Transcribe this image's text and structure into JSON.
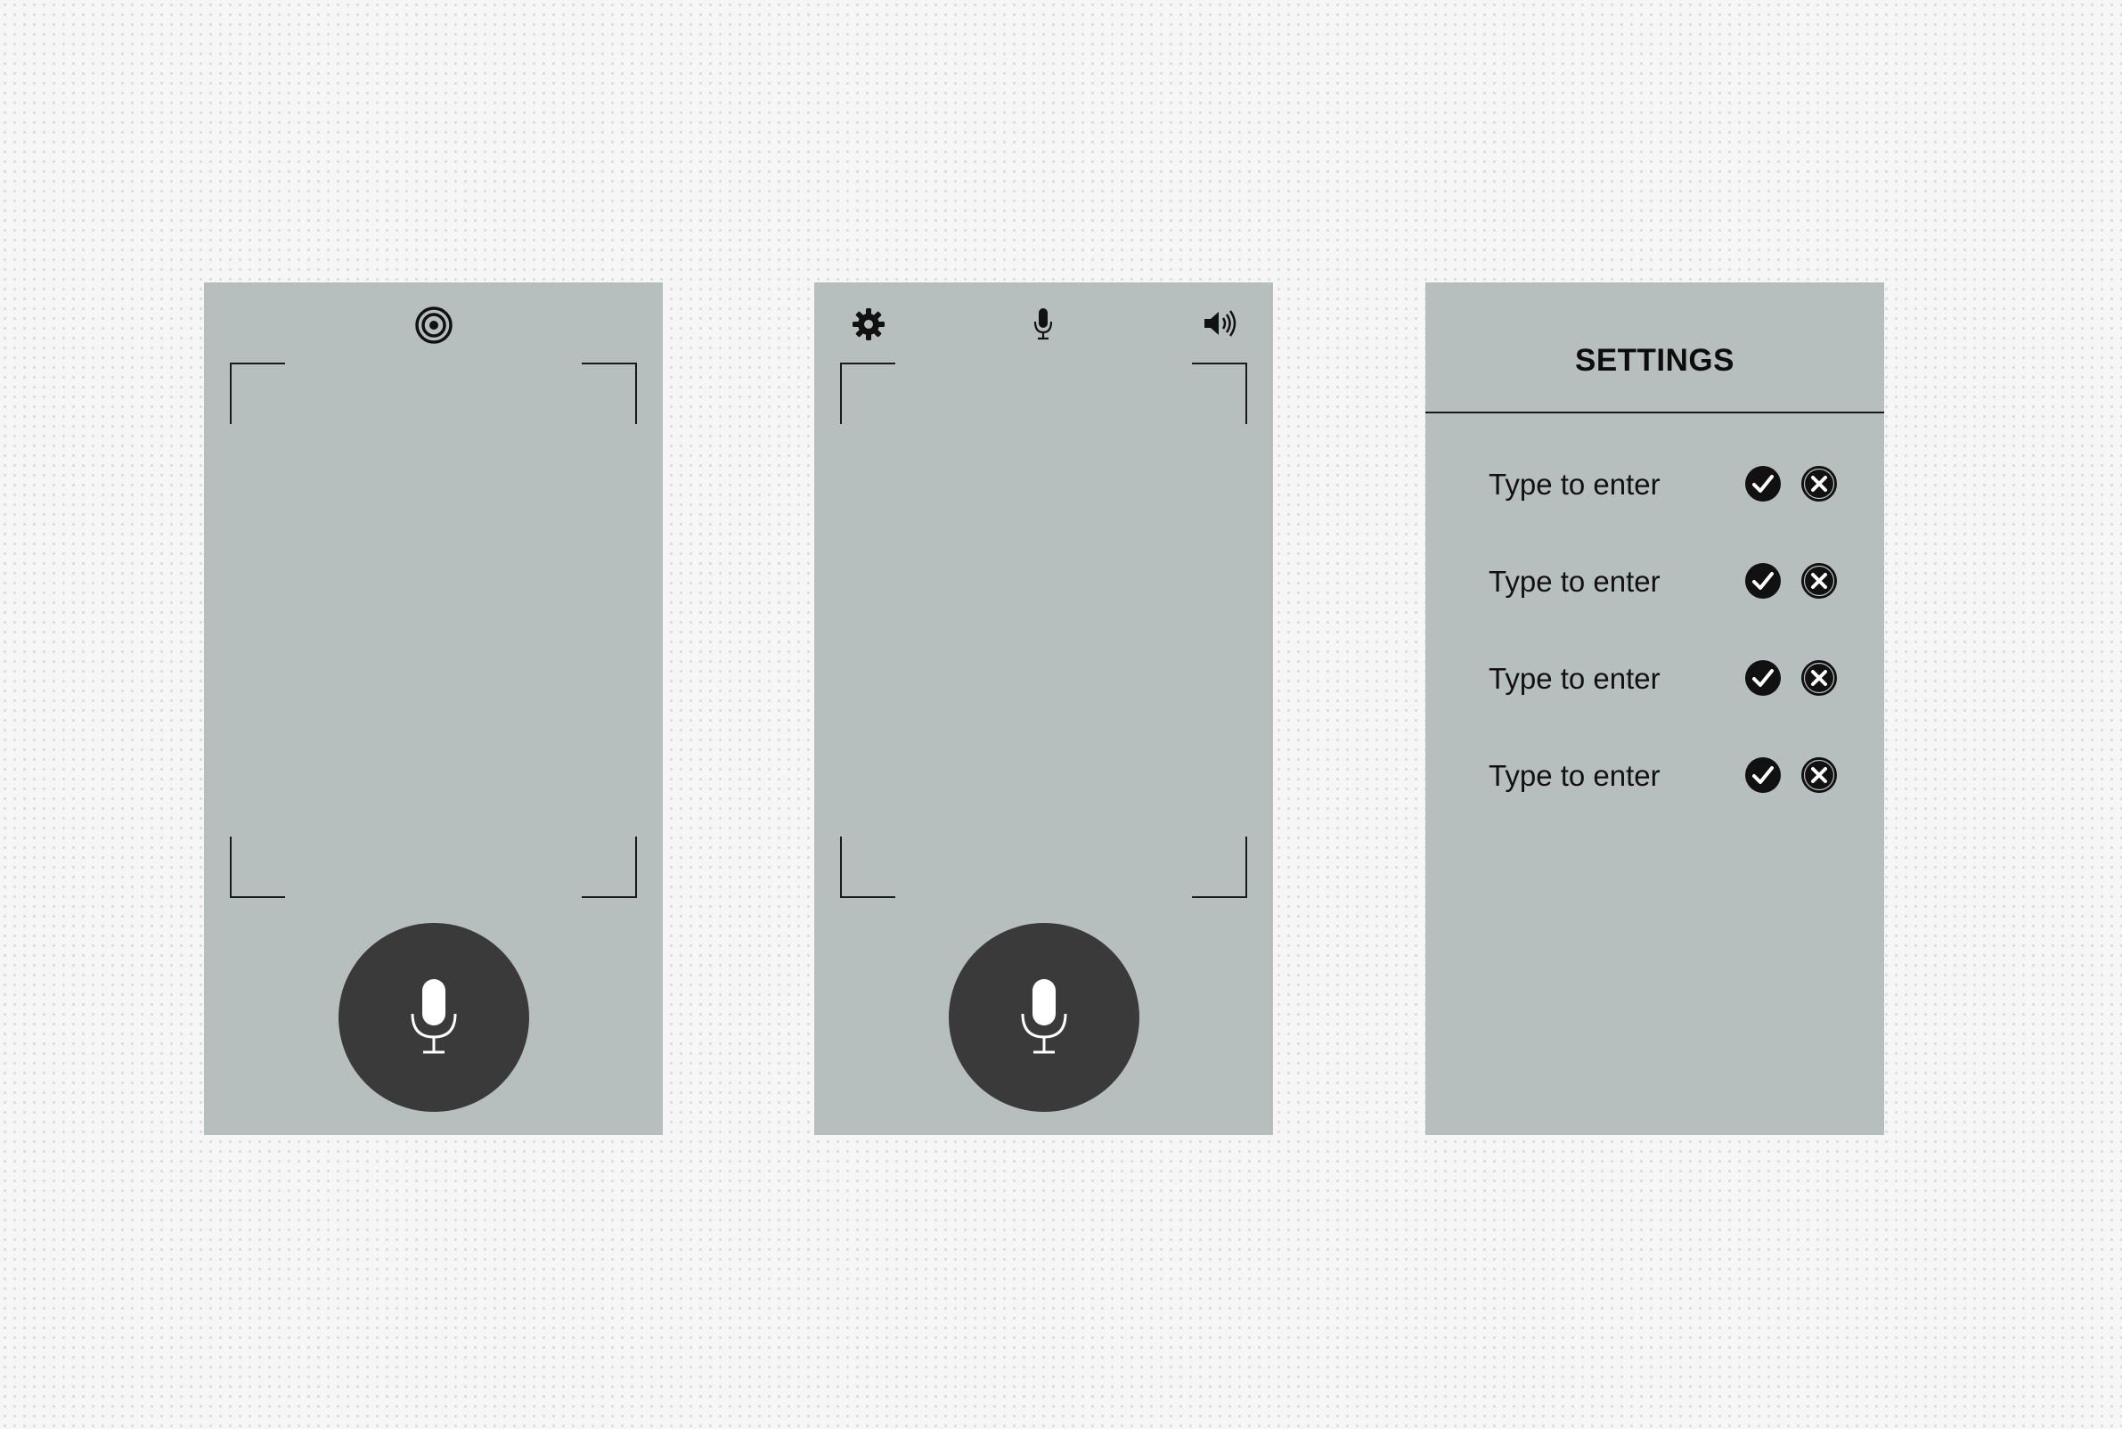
{
  "screens": [
    {
      "id": "recording",
      "top_icon": "target-icon",
      "main_button": "mic-icon"
    },
    {
      "id": "recording-with-toolbar",
      "toolbar_icons": [
        "gear-icon",
        "mic-small-icon",
        "speaker-icon"
      ],
      "main_button": "mic-icon"
    },
    {
      "id": "settings",
      "title": "SETTINGS",
      "rows": [
        {
          "label": "Type to enter",
          "confirm_icon": "check-circle-icon",
          "cancel_icon": "close-circle-icon"
        },
        {
          "label": "Type to enter",
          "confirm_icon": "check-circle-icon",
          "cancel_icon": "close-circle-icon"
        },
        {
          "label": "Type to enter",
          "confirm_icon": "check-circle-icon",
          "cancel_icon": "close-circle-icon"
        },
        {
          "label": "Type to enter",
          "confirm_icon": "check-circle-icon",
          "cancel_icon": "close-circle-icon"
        }
      ]
    }
  ],
  "colors": {
    "canvas_background": "#f6f6f6",
    "screen_background": "#b7bfbe",
    "mic_button": "#3a3a3a",
    "icon_dark": "#111111"
  }
}
